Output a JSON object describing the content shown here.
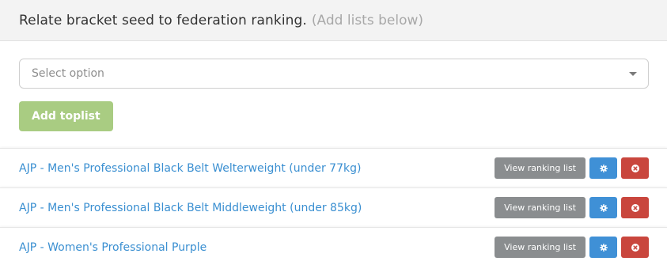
{
  "header": {
    "title": "Relate bracket seed to federation ranking.",
    "hint": "(Add lists below)"
  },
  "select": {
    "placeholder": "Select option",
    "icon": "chevron-down-icon"
  },
  "add_button": {
    "label": "Add toplist"
  },
  "rows": [
    {
      "label": "AJP - Men's Professional Black Belt Welterweight (under 77kg)",
      "view_label": "View ranking list"
    },
    {
      "label": "AJP - Men's Professional Black Belt Middleweight (under 85kg)",
      "view_label": "View ranking list"
    },
    {
      "label": "AJP - Women's Professional Purple",
      "view_label": "View ranking list"
    }
  ],
  "colors": {
    "header_bg": "#f3f3f3",
    "add_button": "#a9cc82",
    "link": "#3a8fd1",
    "view_button": "#8a8d8f",
    "gear_button": "#3f90d6",
    "remove_button": "#c9463d"
  },
  "icons": {
    "settings": "gear-icon",
    "remove": "close-circle-icon"
  }
}
